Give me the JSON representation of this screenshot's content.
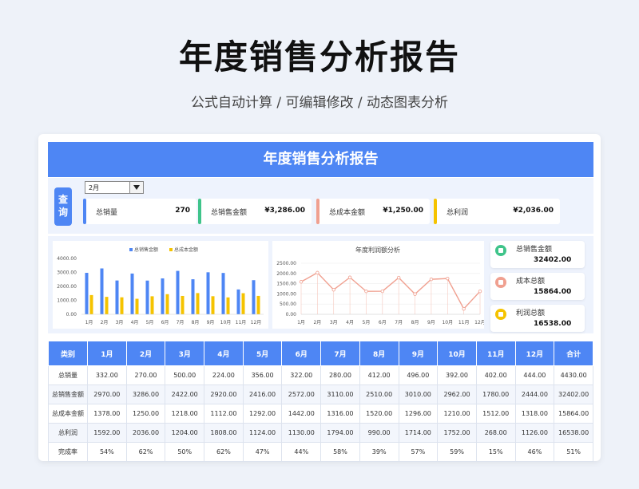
{
  "title": "年度销售分析报告",
  "subtitle": "公式自动计算 /  可编辑修改  / 动态图表分析",
  "report": {
    "banner": "年度销售分析报告",
    "query_label": "查询",
    "selected_month": "2月",
    "kpis": [
      {
        "label": "总销量",
        "value": "270",
        "color": "#4e86f4"
      },
      {
        "label": "总销售金额",
        "value": "¥3,286.00",
        "color": "#3fc48a"
      },
      {
        "label": "总成本金额",
        "value": "¥1,250.00",
        "color": "#f0a090"
      },
      {
        "label": "总利润",
        "value": "¥2,036.00",
        "color": "#f5c300"
      }
    ],
    "side_cards": [
      {
        "label": "总销售金额",
        "value": "32402.00",
        "color": "#3fc48a"
      },
      {
        "label": "成本总额",
        "value": "15864.00",
        "color": "#f0a090"
      },
      {
        "label": "利润总额",
        "value": "16538.00",
        "color": "#f5c300"
      }
    ]
  },
  "chart_data": [
    {
      "type": "bar",
      "title": "",
      "categories": [
        "1月",
        "2月",
        "3月",
        "4月",
        "5月",
        "6月",
        "7月",
        "8月",
        "9月",
        "10月",
        "11月",
        "12月"
      ],
      "ylim": [
        0,
        4000
      ],
      "yticks": [
        "4000.00",
        "3000.00",
        "2000.00",
        "1000.00",
        "0.00"
      ],
      "legend_position": "top",
      "series": [
        {
          "name": "总销售金额",
          "color": "#4e86f4",
          "values": [
            2970,
            3286,
            2422,
            2920,
            2416,
            2572,
            3110,
            2510,
            3010,
            2962,
            1780,
            2444
          ]
        },
        {
          "name": "总成本金额",
          "color": "#f5c300",
          "values": [
            1378,
            1250,
            1218,
            1112,
            1292,
            1442,
            1316,
            1520,
            1296,
            1210,
            1512,
            1318
          ]
        }
      ]
    },
    {
      "type": "line",
      "title": "年度利润额分析",
      "categories": [
        "1月",
        "2月",
        "3月",
        "4月",
        "5月",
        "6月",
        "7月",
        "8月",
        "9月",
        "10月",
        "11月",
        "12月"
      ],
      "ylim": [
        0,
        2500
      ],
      "yticks": [
        "2500.00",
        "2000.00",
        "1500.00",
        "1000.00",
        "500.00",
        "0.00"
      ],
      "series": [
        {
          "name": "",
          "color": "#f0a090",
          "values": [
            1592,
            2036,
            1204,
            1808,
            1124,
            1130,
            1794,
            990,
            1714,
            1752,
            268,
            1126
          ]
        }
      ]
    }
  ],
  "table": {
    "headers": [
      "类别",
      "1月",
      "2月",
      "3月",
      "4月",
      "5月",
      "6月",
      "7月",
      "8月",
      "9月",
      "10月",
      "11月",
      "12月",
      "合计"
    ],
    "rows": [
      [
        "总销量",
        "332.00",
        "270.00",
        "500.00",
        "224.00",
        "356.00",
        "322.00",
        "280.00",
        "412.00",
        "496.00",
        "392.00",
        "402.00",
        "444.00",
        "4430.00"
      ],
      [
        "总销售金额",
        "2970.00",
        "3286.00",
        "2422.00",
        "2920.00",
        "2416.00",
        "2572.00",
        "3110.00",
        "2510.00",
        "3010.00",
        "2962.00",
        "1780.00",
        "2444.00",
        "32402.00"
      ],
      [
        "总成本金额",
        "1378.00",
        "1250.00",
        "1218.00",
        "1112.00",
        "1292.00",
        "1442.00",
        "1316.00",
        "1520.00",
        "1296.00",
        "1210.00",
        "1512.00",
        "1318.00",
        "15864.00"
      ],
      [
        "总利润",
        "1592.00",
        "2036.00",
        "1204.00",
        "1808.00",
        "1124.00",
        "1130.00",
        "1794.00",
        "990.00",
        "1714.00",
        "1752.00",
        "268.00",
        "1126.00",
        "16538.00"
      ],
      [
        "完成率",
        "54%",
        "62%",
        "50%",
        "62%",
        "47%",
        "44%",
        "58%",
        "39%",
        "57%",
        "59%",
        "15%",
        "46%",
        "51%"
      ]
    ]
  }
}
